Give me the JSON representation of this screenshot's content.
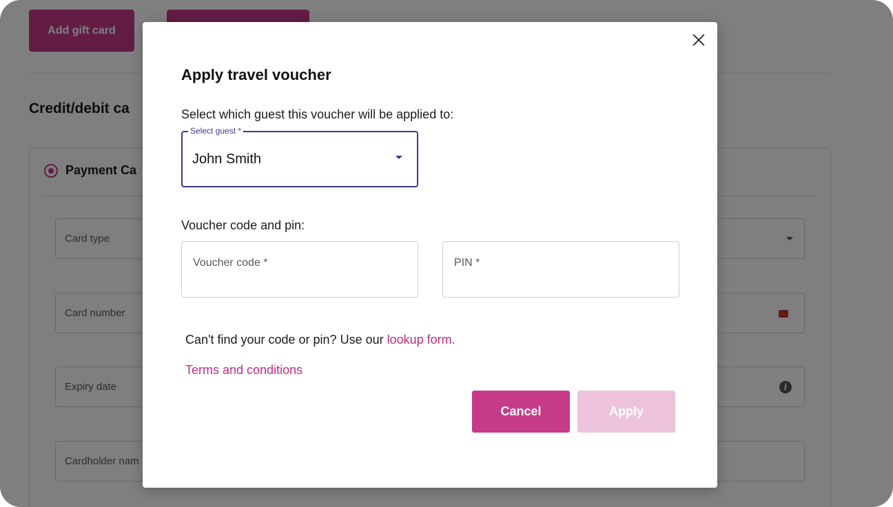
{
  "background": {
    "add_gift_card_label": "Add gift card",
    "section_heading": "Credit/debit ca",
    "payment_card_label": "Payment Ca",
    "fields": [
      {
        "label": "Card type",
        "icon": "chevron-down-icon"
      },
      {
        "label": "Card number",
        "icon": "card-icon"
      },
      {
        "label": "Expiry date",
        "icon": "info-icon"
      },
      {
        "label": "Cardholder nam",
        "icon": ""
      }
    ]
  },
  "modal": {
    "title": "Apply travel voucher",
    "select_prompt": "Select which guest this voucher will be applied to:",
    "select_guest": {
      "label": "Select guest *",
      "value": "John Smith"
    },
    "voucher_section_label": "Voucher code and pin:",
    "voucher_code_placeholder": "Voucher code *",
    "pin_placeholder": "PIN *",
    "lookup_text": "Can't find your code or pin? Use our ",
    "lookup_link": "lookup form.",
    "terms_link": "Terms and conditions",
    "cancel_label": "Cancel",
    "apply_label": "Apply"
  },
  "colors": {
    "accent": "#c63a8a",
    "accent_disabled": "#ecc3da",
    "link": "#c02d85",
    "focus": "#3a3a8c",
    "overlay": "rgba(0,0,0,0.5)"
  }
}
